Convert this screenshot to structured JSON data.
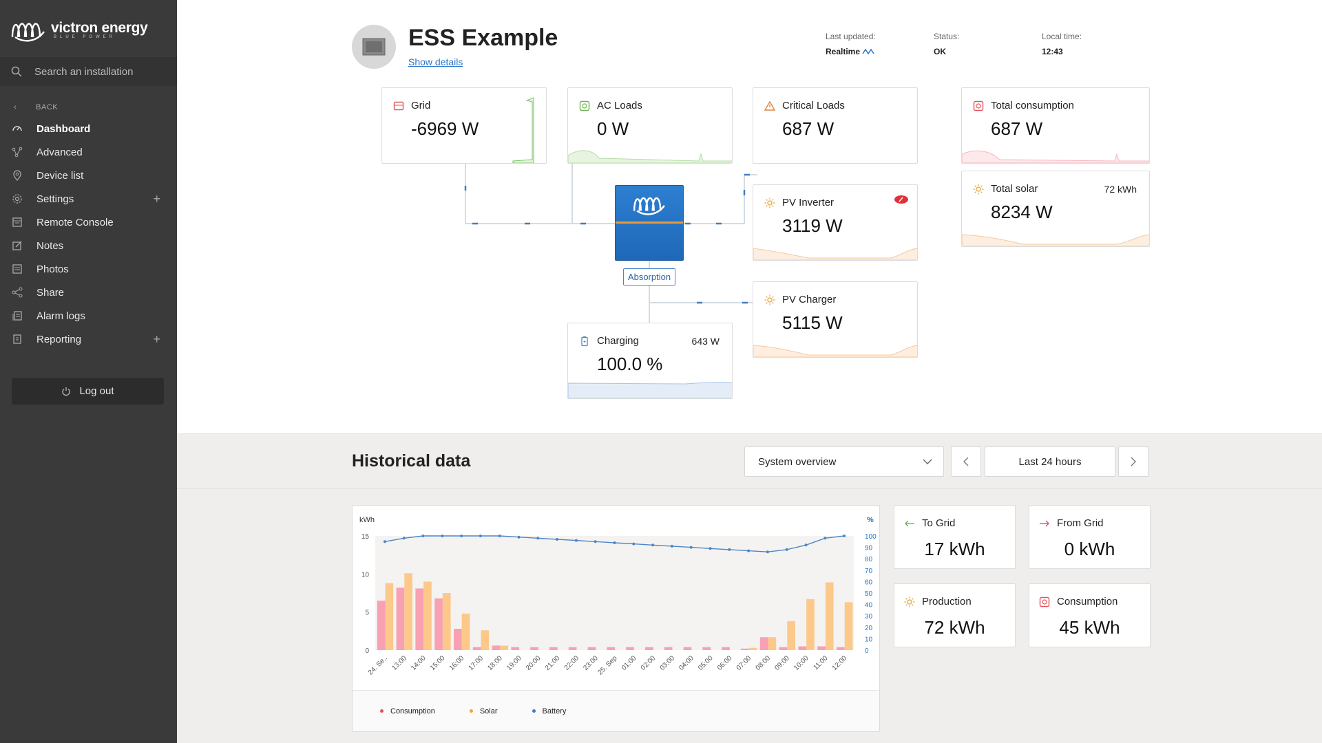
{
  "brand": {
    "name": "victron energy",
    "tagline": "BLUE POWER"
  },
  "search": {
    "placeholder": "Search an installation"
  },
  "sidebar": {
    "back_label": "BACK",
    "items": [
      {
        "label": "Dashboard",
        "icon": "gauge-icon",
        "active": true
      },
      {
        "label": "Advanced",
        "icon": "graph-icon"
      },
      {
        "label": "Device list",
        "icon": "pin-icon"
      },
      {
        "label": "Settings",
        "icon": "gear-icon",
        "plus": true
      },
      {
        "label": "Remote Console",
        "icon": "console-icon"
      },
      {
        "label": "Notes",
        "icon": "edit-icon"
      },
      {
        "label": "Photos",
        "icon": "photo-icon"
      },
      {
        "label": "Share",
        "icon": "share-icon"
      },
      {
        "label": "Alarm logs",
        "icon": "alarm-log-icon"
      },
      {
        "label": "Reporting",
        "icon": "report-icon",
        "plus": true
      }
    ],
    "logout_label": "Log out"
  },
  "header": {
    "title": "ESS Example",
    "show_details": "Show details",
    "last_updated_label": "Last updated:",
    "last_updated_value": "Realtime",
    "status_label": "Status:",
    "status_value": "OK",
    "local_time_label": "Local time:",
    "local_time_value": "12:43"
  },
  "cards": {
    "grid": {
      "title": "Grid",
      "value": "-6969 W"
    },
    "ac_loads": {
      "title": "AC Loads",
      "value": "0 W"
    },
    "critical_loads": {
      "title": "Critical Loads",
      "value": "687 W"
    },
    "pv_inverter": {
      "title": "PV Inverter",
      "value": "3119 W"
    },
    "pv_charger": {
      "title": "PV Charger",
      "value": "5115 W"
    },
    "charging": {
      "title": "Charging",
      "value": "100.0 %",
      "extra": "643 W"
    },
    "total_consumption": {
      "title": "Total consumption",
      "value": "687 W"
    },
    "total_solar": {
      "title": "Total solar",
      "value": "8234 W",
      "extra": "72 kWh"
    }
  },
  "inverter": {
    "state": "Absorption"
  },
  "historical": {
    "title": "Historical data",
    "select_value": "System overview",
    "period": "Last 24 hours"
  },
  "stats": {
    "to_grid": {
      "title": "To Grid",
      "value": "17 kWh"
    },
    "from_grid": {
      "title": "From Grid",
      "value": "0 kWh"
    },
    "production": {
      "title": "Production",
      "value": "72 kWh"
    },
    "consumption": {
      "title": "Consumption",
      "value": "45 kWh"
    }
  },
  "colors": {
    "consumption": "#f7a1b2",
    "solar": "#fcc98a",
    "battery": "#4c86c6",
    "accent": "#2a74c6"
  },
  "chart_data": {
    "type": "bar",
    "ylabel": "kWh",
    "y2label": "%",
    "ylim": [
      0,
      15
    ],
    "y2lim": [
      0,
      100
    ],
    "yticks": [
      0,
      5,
      10,
      15
    ],
    "y2ticks": [
      0,
      10,
      20,
      30,
      40,
      50,
      60,
      70,
      80,
      90,
      100
    ],
    "categories": [
      "24. Se..",
      "13:00",
      "14:00",
      "15:00",
      "16:00",
      "17:00",
      "18:00",
      "19:00",
      "20:00",
      "21:00",
      "22:00",
      "23:00",
      "25. Sep",
      "01:00",
      "02:00",
      "03:00",
      "04:00",
      "05:00",
      "06:00",
      "07:00",
      "08:00",
      "09:00",
      "10:00",
      "11:00",
      "12:00"
    ],
    "series": [
      {
        "name": "Consumption",
        "axis": "left",
        "values": [
          6.5,
          8.2,
          8.1,
          6.8,
          2.8,
          0.4,
          0.6,
          0.4,
          0.4,
          0.4,
          0.4,
          0.4,
          0.4,
          0.4,
          0.4,
          0.4,
          0.4,
          0.4,
          0.4,
          0.2,
          1.7,
          0.4,
          0.5,
          0.5,
          0.4
        ]
      },
      {
        "name": "Solar",
        "axis": "left",
        "values": [
          8.8,
          10.1,
          9.0,
          7.5,
          4.8,
          2.6,
          0.6,
          0,
          0,
          0,
          0,
          0,
          0,
          0,
          0,
          0,
          0,
          0,
          0,
          0.3,
          1.7,
          3.8,
          6.7,
          8.9,
          6.3
        ]
      },
      {
        "name": "Battery",
        "axis": "right",
        "values": [
          95,
          98,
          100,
          100,
          100,
          100,
          100,
          99,
          98,
          97,
          96,
          95,
          94,
          93,
          92,
          91,
          90,
          89,
          88,
          87,
          86,
          88,
          92,
          98,
          100
        ]
      }
    ],
    "legend": "bottom",
    "grid": false
  }
}
